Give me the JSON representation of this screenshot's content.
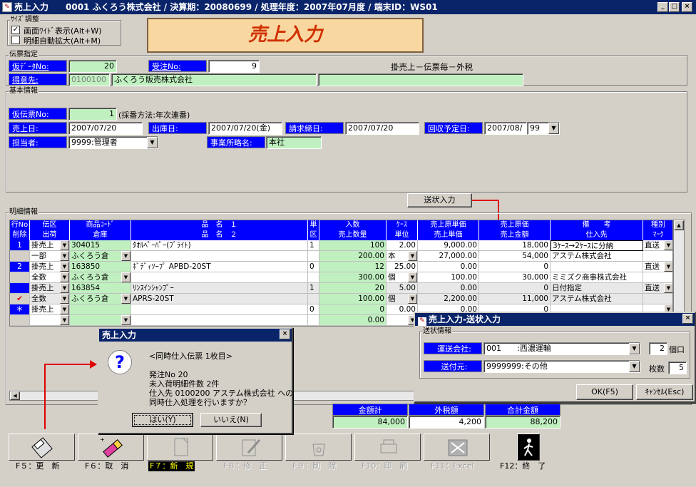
{
  "window": {
    "title": "売上入力　　0001 ふくろう株式会社 / 決算期：20080699 / 処理年度：2007年07月度 / 端末ID：WS01",
    "icon": "window-icon"
  },
  "size_adjust": {
    "label": "ｻｲｽﾞ調整",
    "wide": "画面ﾜｲﾄﾞ表示(Alt+W)",
    "wide_checked": "✓",
    "auto": "明細自動拡大(Alt+M)"
  },
  "banner": "売上入力",
  "slip": {
    "label": "伝票指定",
    "temp_data_no_label": "仮ﾃﾞｰﾀNo:",
    "temp_data_no": "20",
    "order_no_label": "受注No:",
    "order_no": "9",
    "type_text": "掛売上－伝票毎－外税",
    "customer_label": "得意先:",
    "customer_code": "0100100",
    "customer_name": "ふくろう販売株式会社"
  },
  "basic": {
    "label": "基本情報",
    "temp_slip_no_label": "仮伝票No:",
    "temp_slip_no": "1",
    "numbering": "(採番方法:年次連番)",
    "sales_date_label": "売上日:",
    "sales_date": "2007/07/20",
    "ship_date_label": "出庫日:",
    "ship_date": "2007/07/20(金)",
    "bill_close_label": "請求締日:",
    "bill_close": "2007/07/20",
    "collect_label": "回収予定日:",
    "collect_date": "2007/08/",
    "collect_day": "99",
    "staff_label": "担当者:",
    "staff": "9999:管理者",
    "office_label": "事業所略名:",
    "office": "本社"
  },
  "send_button": "送状入力",
  "detail": {
    "label": "明細情報",
    "header1": [
      "行No",
      "伝区",
      "商品ｺｰﾄﾞ",
      "品　名　１",
      "単",
      "入数",
      "ｹｰｽ",
      "売上原単価",
      "売上原価",
      "備　　考",
      "種別"
    ],
    "header2": [
      "削除",
      "出荷",
      "倉庫",
      "品　名　２",
      "区",
      "売上数量",
      "単位",
      "売上単価",
      "売上金額",
      "仕入先",
      "ﾏｰｸ"
    ],
    "rows": [
      {
        "no": "1",
        "kind": "掛売上",
        "code": "304015",
        "name1": "ﾀｵﾙﾍﾟｰﾊﾟｰ(ﾌﾞﾗｲﾄ)",
        "tanku": "1",
        "irisu": "100",
        "case": "2.00",
        "cost_unit": "9,000.00",
        "cost": "18,000",
        "note": "3ｹｰｽ→2ｹｰｽに分納",
        "class": "直送",
        "ship": "一部",
        "warehouse": "ふくろう倉",
        "name2": "",
        "qty": "200.00",
        "unit": "本",
        "price": "27,000.00",
        "amount": "54,000",
        "supplier": "アステム株式会社",
        "del": ""
      },
      {
        "no": "2",
        "kind": "掛売上",
        "code": "163850",
        "name1": "ﾎﾞﾃﾞｨｿｰﾌﾟ APBD-20ST",
        "tanku": "0",
        "irisu": "12",
        "case": "25.00",
        "cost_unit": "0.00",
        "cost": "0",
        "note": "",
        "class": "直送",
        "ship": "全数",
        "warehouse": "ふくろう倉",
        "name2": "",
        "qty": "300.00",
        "unit": "個",
        "price": "100.00",
        "amount": "30,000",
        "supplier": "ミミズク商事株式会社",
        "del": ""
      },
      {
        "no": "",
        "kind": "掛売上",
        "code": "163854",
        "name1": "ﾘﾝｽｲﾝｼｬﾝﾌﾟｰ",
        "tanku": "1",
        "irisu": "20",
        "case": "5.00",
        "cost_unit": "0.00",
        "cost": "0",
        "note": "日付指定",
        "class": "直送",
        "ship": "全数",
        "warehouse": "ふくろう倉",
        "name2": "APRS-20ST",
        "qty": "100.00",
        "unit": "個",
        "price": "2,200.00",
        "amount": "11,000",
        "supplier": "アステム株式会社",
        "del": "✔"
      },
      {
        "no": "＊",
        "kind": "掛売上",
        "code": "",
        "name1": "",
        "tanku": "0",
        "irisu": "0",
        "case": "0.00",
        "cost_unit": "0.00",
        "cost": "0",
        "note": "",
        "class": "",
        "ship": "",
        "warehouse": "",
        "name2": "",
        "qty": "0.00",
        "unit": "",
        "price": "",
        "amount": "",
        "supplier": "",
        "del": ""
      }
    ]
  },
  "totals": {
    "amount_label": "金額計",
    "amount": "84,000",
    "tax_label": "外税額",
    "tax": "4,200",
    "total_label": "合計金額",
    "total": "88,200"
  },
  "fkeys": [
    {
      "label": "F５：更　新",
      "icon": "save-disk-icon"
    },
    {
      "label": "F６：取　消",
      "icon": "eraser-icon"
    },
    {
      "label": "F７：新　規",
      "icon": "new-doc-icon"
    },
    {
      "label": "F８：修　正",
      "icon": "edit-icon"
    },
    {
      "label": "F９：削　除",
      "icon": "delete-icon"
    },
    {
      "label": "F10：印　刷",
      "icon": "printer-icon"
    },
    {
      "label": "F11：Excel",
      "icon": "excel-icon"
    },
    {
      "label": "F12：終　了",
      "icon": "exit-icon"
    }
  ],
  "msgbox": {
    "title": "売上入力",
    "heading": "<同時仕入伝票 1枚目>",
    "line1": "発注No 20",
    "line2": "未入荷明細件数 2件",
    "line3": "仕入先 0100200 アステム株式会社 への",
    "line4": "同時仕入処理を行いますか？",
    "yes": "はい(Y)",
    "no": "いいえ(N)"
  },
  "ship_dialog": {
    "title": "売上入力-送状入力",
    "group": "送状情報",
    "carrier_label": "運送会社:",
    "carrier": "001　　:西濃運輸",
    "qty": "2",
    "qty_unit": "個口",
    "dest_label": "送付元:",
    "dest": "9999999:その他",
    "sheets_label": "枚数",
    "sheets": "5",
    "ok": "OK(F5)",
    "cancel": "ｷｬﾝｾﾙ(Esc)"
  }
}
